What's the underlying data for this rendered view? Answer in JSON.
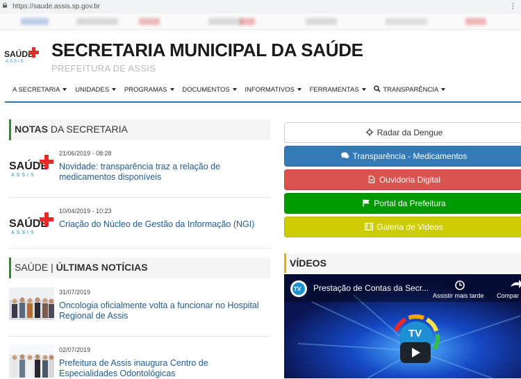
{
  "browser": {
    "url": "https://saude.assis.sp.gov.br"
  },
  "header": {
    "logo_text": "SAÚDE",
    "logo_sub": "ASSIS",
    "title": "SECRETARIA MUNICIPAL DA SAÚDE",
    "subtitle": "PREFEITURA DE ASSIS"
  },
  "nav": {
    "items": [
      "A SECRETARIA",
      "UNIDADES",
      "PROGRAMAS",
      "DOCUMENTOS",
      "INFORMATIVOS",
      "FERRAMENTAS",
      "TRANSPARÊNCIA"
    ]
  },
  "notas": {
    "title_bold": "NOTAS",
    "title_rest": " DA SECRETARIA",
    "items": [
      {
        "date": "21/06/2019 - 08:28",
        "headline": "Novidade: transparência traz a relação de medicamentos disponíveis"
      },
      {
        "date": "10/04/2019 - 10:23",
        "headline": "Criação do Núcleo de Gestão da Informação (NGI)"
      }
    ]
  },
  "noticias": {
    "title_rest": "SAÚDE | ",
    "title_bold": "ÚLTIMAS NOTÍCIAS",
    "items": [
      {
        "date": "31/07/2019",
        "headline": "Oncologia oficialmente volta a funcionar no Hospital Regional de Assis"
      },
      {
        "date": "02/07/2019",
        "headline": "Prefeitura de Assis inaugura Centro de Especialidades Odontológicas"
      }
    ]
  },
  "quick_links": [
    {
      "label": "Radar da Dengue",
      "icon": "crosshair-icon",
      "bg": "#ffffff",
      "fg": "#333333",
      "border": "#cccccc"
    },
    {
      "label": "Transparência - Medicamentos",
      "icon": "comments-icon",
      "bg": "#337ab7",
      "fg": "#ffffff",
      "border": "#2e6da4"
    },
    {
      "label": "Ouvidoria Digital",
      "icon": "document-icon",
      "bg": "#d9534f",
      "fg": "#ffffff",
      "border": "#d43f3a"
    },
    {
      "label": "Portal da Prefeitura",
      "icon": "flag-icon",
      "bg": "#009900",
      "fg": "#ffffff",
      "border": "#008800"
    },
    {
      "label": "Galeria de Videos",
      "icon": "film-icon",
      "bg": "#cccc00",
      "fg": "#ffffff",
      "border": "#bbbb00"
    }
  ],
  "videos": {
    "title": "VÍDEOS",
    "embed_title": "Prestação de Contas da Secr...",
    "watch_later": "Assistir mais tarde",
    "share": "Compar"
  },
  "colors": {
    "accent_blue": "#2f6fa6",
    "link_blue": "#1f5b93",
    "section_green": "#2e8b2e",
    "video_yellow": "#d4b800",
    "logo_red": "#e32b2b"
  }
}
